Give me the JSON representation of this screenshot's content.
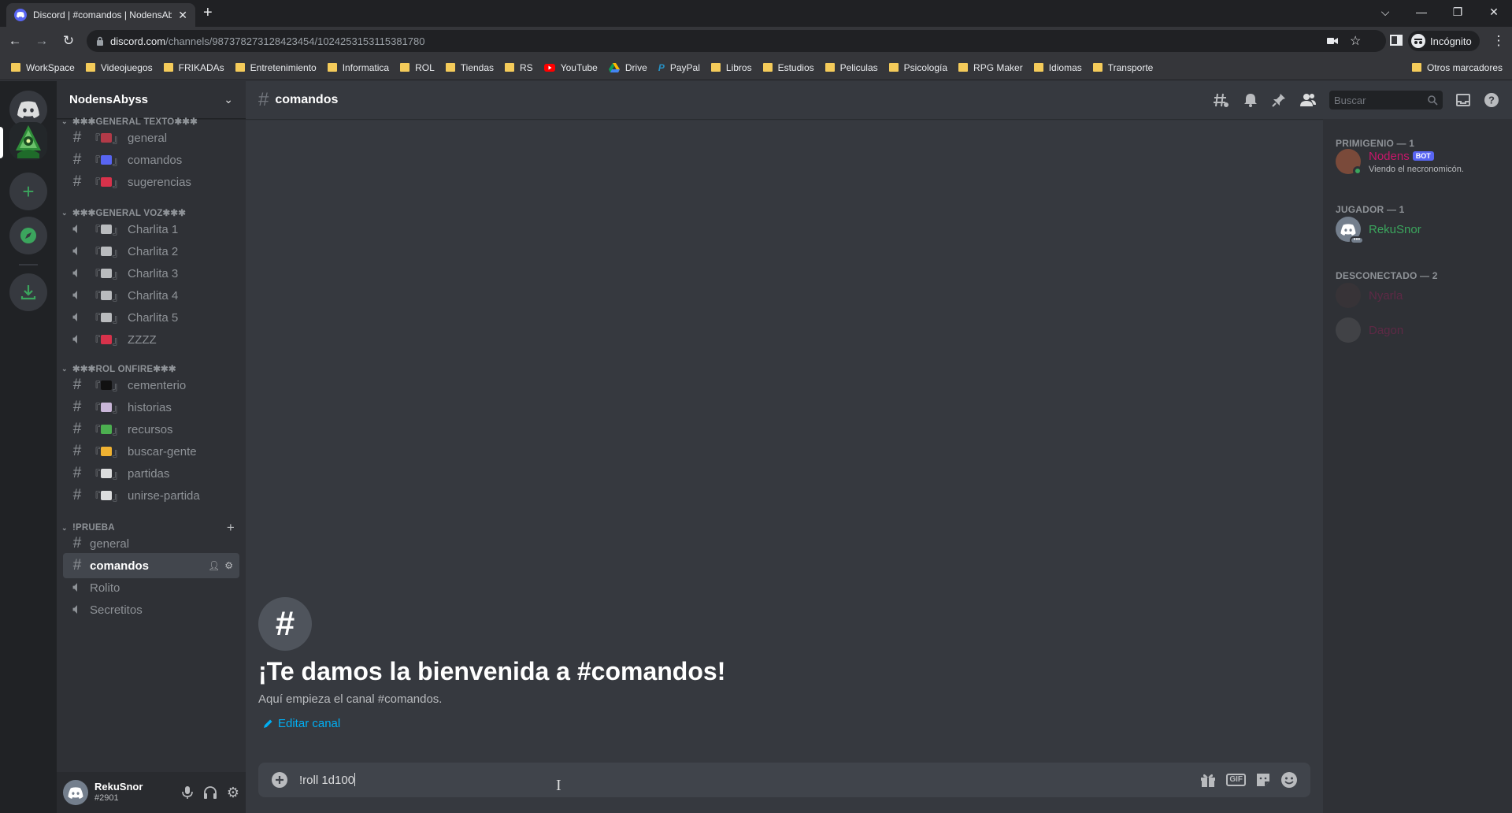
{
  "browser": {
    "tab_title": "Discord | #comandos | NodensAbyss",
    "url_host": "discord.com",
    "url_path": "/channels/987378273128423454/1024253153115381780",
    "incognito_label": "Incógnito",
    "bookmarks": [
      "WorkSpace",
      "Videojuegos",
      "FRIKADAs",
      "Entretenimiento",
      "Informatica",
      "ROL",
      "Tiendas",
      "RS",
      "YouTube",
      "Drive",
      "PayPal",
      "Libros",
      "Estudios",
      "Peliculas",
      "Psicología",
      "RPG Maker",
      "Idiomas",
      "Transporte"
    ],
    "other_bookmarks": "Otros marcadores"
  },
  "server": {
    "name": "NodensAbyss",
    "categories": [
      {
        "label": "✱✱✱GENERAL TEXTO✱✱✱"
      },
      {
        "label": "✱✱✱GENERAL VOZ✱✱✱"
      },
      {
        "label": "✱✱✱ROL ONFIRE✱✱✱"
      },
      {
        "label": "!PRUEBA"
      }
    ],
    "channels": [
      {
        "label": "general",
        "type": "text"
      },
      {
        "label": "comandos",
        "type": "text"
      },
      {
        "label": "sugerencias",
        "type": "text"
      },
      {
        "label": "Charlita 1",
        "type": "voice"
      },
      {
        "label": "Charlita 2",
        "type": "voice"
      },
      {
        "label": "Charlita 3",
        "type": "voice"
      },
      {
        "label": "Charlita 4",
        "type": "voice"
      },
      {
        "label": "Charlita 5",
        "type": "voice"
      },
      {
        "label": "ZZZZ",
        "type": "voice"
      },
      {
        "label": "cementerio",
        "type": "text"
      },
      {
        "label": "historias",
        "type": "text"
      },
      {
        "label": "recursos",
        "type": "text"
      },
      {
        "label": "buscar-gente",
        "type": "text"
      },
      {
        "label": "partidas",
        "type": "text"
      },
      {
        "label": "unirse-partida",
        "type": "text"
      },
      {
        "label": "general",
        "type": "text"
      },
      {
        "label": "comandos",
        "type": "text",
        "active": true
      },
      {
        "label": "Rolito",
        "type": "voice"
      },
      {
        "label": "Secretitos",
        "type": "voice"
      }
    ]
  },
  "user": {
    "name": "RekuSnor",
    "tag": "#2901"
  },
  "channel": {
    "name": "comandos",
    "search_placeholder": "Buscar",
    "welcome_title": "¡Te damos la bienvenida a #comandos!",
    "welcome_sub": "Aquí empieza el canal #comandos.",
    "edit_label": "Editar canal",
    "composer_value": "!roll 1d100"
  },
  "members": {
    "groups": [
      {
        "label": "PRIMIGENIO — 1"
      },
      {
        "label": "JUGADOR — 1"
      },
      {
        "label": "DESCONECTADO — 2"
      }
    ],
    "list": [
      {
        "name": "Nodens",
        "badge": "BOT",
        "status": "Viendo el necronomicón.",
        "color": "#c7176a"
      },
      {
        "name": "RekuSnor",
        "color": "#3ba55d"
      },
      {
        "name": "Nyarla",
        "color": "#c7176a"
      },
      {
        "name": "Dagon",
        "color": "#c7176a"
      }
    ]
  },
  "colors": {
    "accent": "#5865f2",
    "link": "#00aff4",
    "online": "#3ba55d"
  }
}
